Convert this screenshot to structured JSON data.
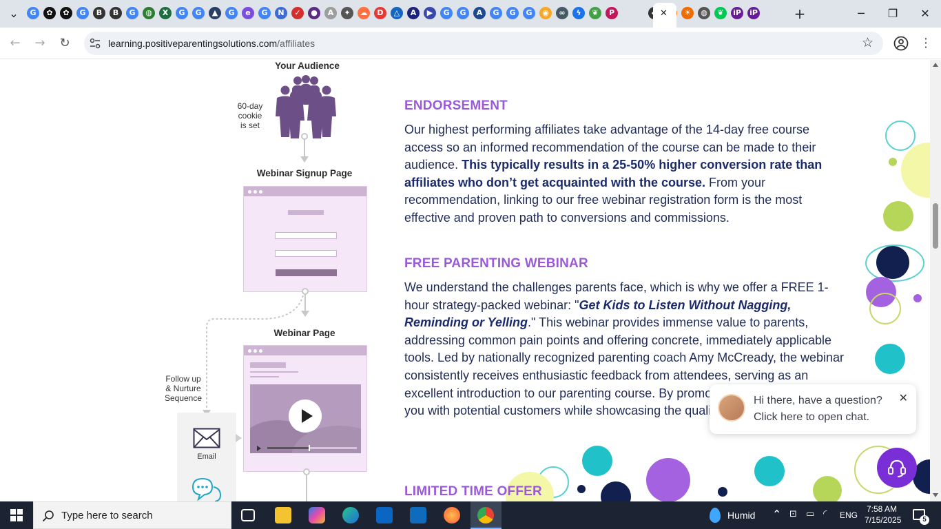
{
  "browser": {
    "url_host": "learning.positiveparentingsolutions.com",
    "url_path": "/affiliates",
    "close_tab_symbol": "✕",
    "new_tab_symbol": "+"
  },
  "tabs": [
    {
      "icon": "google-icon",
      "color": "#4285f4"
    },
    {
      "icon": "openai-icon",
      "color": "#111"
    },
    {
      "icon": "openai-icon",
      "color": "#111"
    },
    {
      "icon": "google-icon",
      "color": "#4285f4"
    },
    {
      "icon": "b-icon",
      "color": "#333"
    },
    {
      "icon": "b-icon",
      "color": "#333"
    },
    {
      "icon": "google-icon",
      "color": "#4285f4"
    },
    {
      "icon": "globe-icon",
      "color": "#2e7d32"
    },
    {
      "icon": "excel-icon",
      "color": "#1d6f42"
    },
    {
      "icon": "google-icon",
      "color": "#4285f4"
    },
    {
      "icon": "google-icon",
      "color": "#4285f4"
    },
    {
      "icon": "cap-icon",
      "color": "#2a3f64"
    },
    {
      "icon": "google-icon",
      "color": "#4285f4"
    },
    {
      "icon": "e-icon",
      "color": "#7b4ce0"
    },
    {
      "icon": "google-icon",
      "color": "#4285f4"
    },
    {
      "icon": "n-icon",
      "color": "#3d6bd4"
    },
    {
      "icon": "check-icon",
      "color": "#d32f2f"
    },
    {
      "icon": "circle-icon",
      "color": "#5a2d82"
    },
    {
      "icon": "ads-icon",
      "color": "#9e9e9e"
    },
    {
      "icon": "gear-icon",
      "color": "#555"
    },
    {
      "icon": "cloud-icon",
      "color": "#ff7043"
    },
    {
      "icon": "d-icon",
      "color": "#e53935"
    },
    {
      "icon": "triangle-icon",
      "color": "#1565c0"
    },
    {
      "icon": "a-icon",
      "color": "#1a237e"
    },
    {
      "icon": "play-icon",
      "color": "#3949ab"
    },
    {
      "icon": "google-icon",
      "color": "#4285f4"
    },
    {
      "icon": "google-icon",
      "color": "#4285f4"
    },
    {
      "icon": "az-icon",
      "color": "#1e4b8f"
    },
    {
      "icon": "google-icon",
      "color": "#4285f4"
    },
    {
      "icon": "google-icon",
      "color": "#4285f4"
    },
    {
      "icon": "google-icon",
      "color": "#4285f4"
    },
    {
      "icon": "eye-icon",
      "color": "#f9a825"
    },
    {
      "icon": "link-icon",
      "color": "#455a64"
    },
    {
      "icon": "bolt-icon",
      "color": "#1a73e8"
    },
    {
      "icon": "leaf-icon",
      "color": "#43a047"
    },
    {
      "icon": "p-icon",
      "color": "#c2185b"
    },
    {
      "icon": "shield-icon",
      "color": "#333"
    },
    {
      "icon": "star-icon",
      "color": "#ff6f00"
    },
    {
      "icon": "sun-icon",
      "color": "#ef6c00"
    },
    {
      "icon": "globe-icon",
      "color": "#555"
    },
    {
      "icon": "leaf-icon",
      "color": "#00c853"
    },
    {
      "icon": "ip-icon",
      "color": "#6a1b9a"
    },
    {
      "icon": "ip-icon",
      "color": "#6a1b9a"
    }
  ],
  "flow": {
    "audience_label": "Your Audience",
    "cookie_note": [
      "60-day",
      "cookie",
      "is set"
    ],
    "signup_label": "Webinar Signup Page",
    "webinar_label": "Webinar Page",
    "followup_note": [
      "Follow up",
      "& Nurture",
      "Sequence"
    ],
    "email_label": "Email"
  },
  "content": {
    "endorsement_heading": "ENDORSEMENT",
    "endorsement_p1": "Our highest performing affiliates take advantage of the 14-day free course access so an informed recommendation of the course can be made to their audience. ",
    "endorsement_bold": "This typically results in a 25-50% higher conversion rate than affiliates who don’t get acquainted with the course.",
    "endorsement_p2": " From your recommendation, linking to our free webinar registration form is the most effective and proven path to conversions and commissions.",
    "webinar_heading": "FREE PARENTING WEBINAR",
    "webinar_p1": "We understand the challenges parents face, which is why we offer a FREE 1-hour strategy-packed webinar: \"",
    "webinar_title": "Get Kids to Listen Without Nagging, Reminding or Yelling",
    "webinar_p2": ".\" This webinar provides immense value to parents, addressing common pain points and offering concrete, immediately applicable tools. Led by nationally recognized parenting coach Amy McCready, the webinar consistently receives enthusiastic feedback from attendees, serving as an excellent introduction to our parenting course. By promoting this free resource, you with potential customers while showcasing the quality our full program.",
    "limited_heading": "LIMITED TIME OFFER"
  },
  "chat": {
    "line1": "Hi there, have a question?",
    "line2": "Click here to open chat.",
    "close_symbol": "✕"
  },
  "taskbar": {
    "search_placeholder": "Type here to search",
    "weather": "Humid",
    "language": "ENG",
    "time": "7:58 AM",
    "date": "7/15/2025",
    "notification_count": "5"
  },
  "colors": {
    "heading_purple": "#9a5ad8",
    "body_navy": "#1f2b55",
    "chat_purple": "#7a2fd6",
    "mock_lilac": "#f5e6f8"
  }
}
